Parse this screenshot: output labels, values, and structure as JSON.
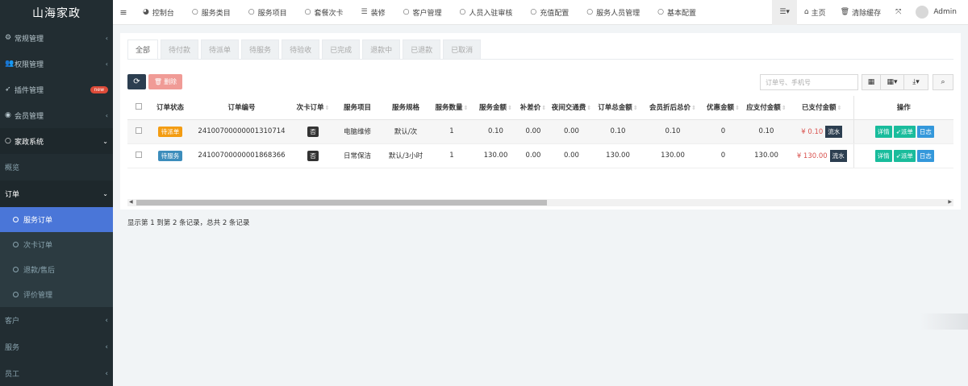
{
  "sidebar": {
    "brand": "山海家政",
    "items": [
      {
        "label": "常规管理",
        "icon": "gears-icon"
      },
      {
        "label": "权限管理",
        "icon": "users-icon"
      },
      {
        "label": "插件管理",
        "icon": "rocket-icon",
        "badge": "new"
      },
      {
        "label": "会员管理",
        "icon": "user-circle-icon"
      },
      {
        "label": "家政系统",
        "icon": "circle-icon"
      }
    ],
    "overview": "概览",
    "order_group": "订单",
    "sub_items": [
      "服务订单",
      "次卡订单",
      "退款/售后",
      "评价管理"
    ],
    "tail_items": [
      "客户",
      "服务",
      "员工"
    ]
  },
  "topnav": {
    "items": [
      {
        "label": "控制台",
        "icon": "dashboard-icon"
      },
      {
        "label": "服务类目",
        "icon": "circle-icon"
      },
      {
        "label": "服务项目",
        "icon": "circle-icon"
      },
      {
        "label": "套餐次卡",
        "icon": "circle-icon"
      },
      {
        "label": "装修",
        "icon": "list-icon"
      },
      {
        "label": "客户管理",
        "icon": "circle-icon"
      },
      {
        "label": "人员入驻审核",
        "icon": "circle-icon"
      },
      {
        "label": "充值配置",
        "icon": "circle-icon"
      },
      {
        "label": "服务人员管理",
        "icon": "circle-icon"
      },
      {
        "label": "基本配置",
        "icon": "circle-icon"
      }
    ],
    "home": "主页",
    "clear_cache": "清除缓存",
    "user": "Admin"
  },
  "tabs": [
    "全部",
    "待付款",
    "待派单",
    "待服务",
    "待验收",
    "已完成",
    "退款中",
    "已退款",
    "已取消"
  ],
  "toolbar": {
    "delete_label": "删除",
    "search_placeholder": "订单号、手机号"
  },
  "table": {
    "headers": [
      "订单状态",
      "订单编号",
      "次卡订单",
      "服务项目",
      "服务规格",
      "服务数量",
      "服务金额",
      "补差价",
      "夜间交通费",
      "订单总金额",
      "会员折后总价",
      "优惠金额",
      "应支付金额",
      "已支付金额",
      "操作"
    ],
    "rows": [
      {
        "status": "待派单",
        "order_no": "24100700000001310714",
        "card": "否",
        "service": "电脑维修",
        "spec": "默认/次",
        "qty": "1",
        "amount": "0.10",
        "diff": "0.00",
        "night": "0.00",
        "total": "0.10",
        "member_total": "0.10",
        "discount": "0",
        "payable": "0.10",
        "paid": "¥ 0.10"
      },
      {
        "status": "待服务",
        "order_no": "24100700000001868366",
        "card": "否",
        "service": "日常保洁",
        "spec": "默认/3小时",
        "qty": "1",
        "amount": "130.00",
        "diff": "0.00",
        "night": "0.00",
        "total": "130.00",
        "member_total": "130.00",
        "discount": "0",
        "payable": "130.00",
        "paid": "¥ 130.00"
      }
    ],
    "flow_label": "流水",
    "op_detail": "详情",
    "op_dispatch": "派单",
    "op_log": "日志"
  },
  "pager": "显示第 1 到第 2 条记录，总共 2 条记录",
  "colors": {
    "sidebar_bg": "#222d32",
    "active": "#4a76d8",
    "pending_dispatch": "#f39c12",
    "pending_service": "#3c8dbc"
  }
}
